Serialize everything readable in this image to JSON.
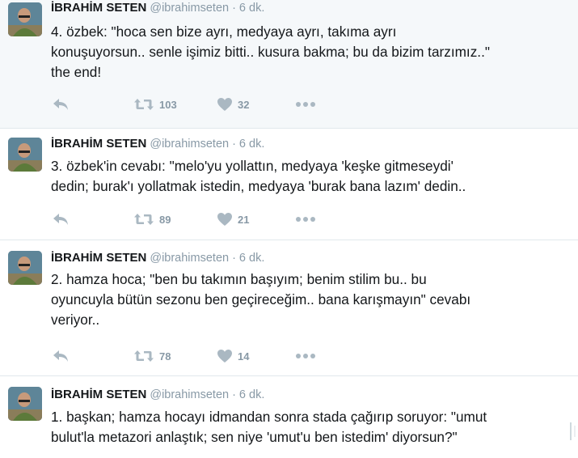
{
  "tweets": [
    {
      "author_name": "İBRAHİM SETEN",
      "handle": "@ibrahimseten",
      "separator": "·",
      "time": "6 dk.",
      "text": "4. özbek: \"hoca sen bize ayrı, medyaya ayrı, takıma ayrı\nkonuşuyorsun.. senle işimiz bitti.. kusura bakma; bu da bizim tarzımız..\"\nthe end!",
      "retweets": "103",
      "likes": "32"
    },
    {
      "author_name": "İBRAHİM SETEN",
      "handle": "@ibrahimseten",
      "separator": "·",
      "time": "6 dk.",
      "text": "3. özbek'in cevabı: \"melo'yu yollattın, medyaya 'keşke gitmeseydi'\ndedin; burak'ı yollatmak istedin, medyaya 'burak bana lazım' dedin..",
      "retweets": "89",
      "likes": "21"
    },
    {
      "author_name": "İBRAHİM SETEN",
      "handle": "@ibrahimseten",
      "separator": "·",
      "time": "6 dk.",
      "text": "2. hamza hoca; \"ben bu takımın başıyım; benim stilim bu.. bu\noyuncuyla bütün sezonu ben geçireceğim.. bana karışmayın\" cevabı\nveriyor..",
      "retweets": "78",
      "likes": "14"
    },
    {
      "author_name": "İBRAHİM SETEN",
      "handle": "@ibrahimseten",
      "separator": "·",
      "time": "6 dk.",
      "text": "1. başkan; hamza hocayı idmandan sonra stada çağırıp soruyor: \"umut\nbulut'la metazori anlaştık; sen niye 'umut'u ben istedim' diyorsun?\"",
      "retweets": "",
      "likes": ""
    }
  ],
  "colors": {
    "icon_gray": "#aab8c2",
    "count_gray": "#8899a6",
    "meta_gray": "#8899a6",
    "divider": "#e1e8ed",
    "shaded_bg": "#f5f8fa"
  },
  "icons": [
    "reply-icon",
    "retweet-icon",
    "heart-icon",
    "more-icon"
  ]
}
